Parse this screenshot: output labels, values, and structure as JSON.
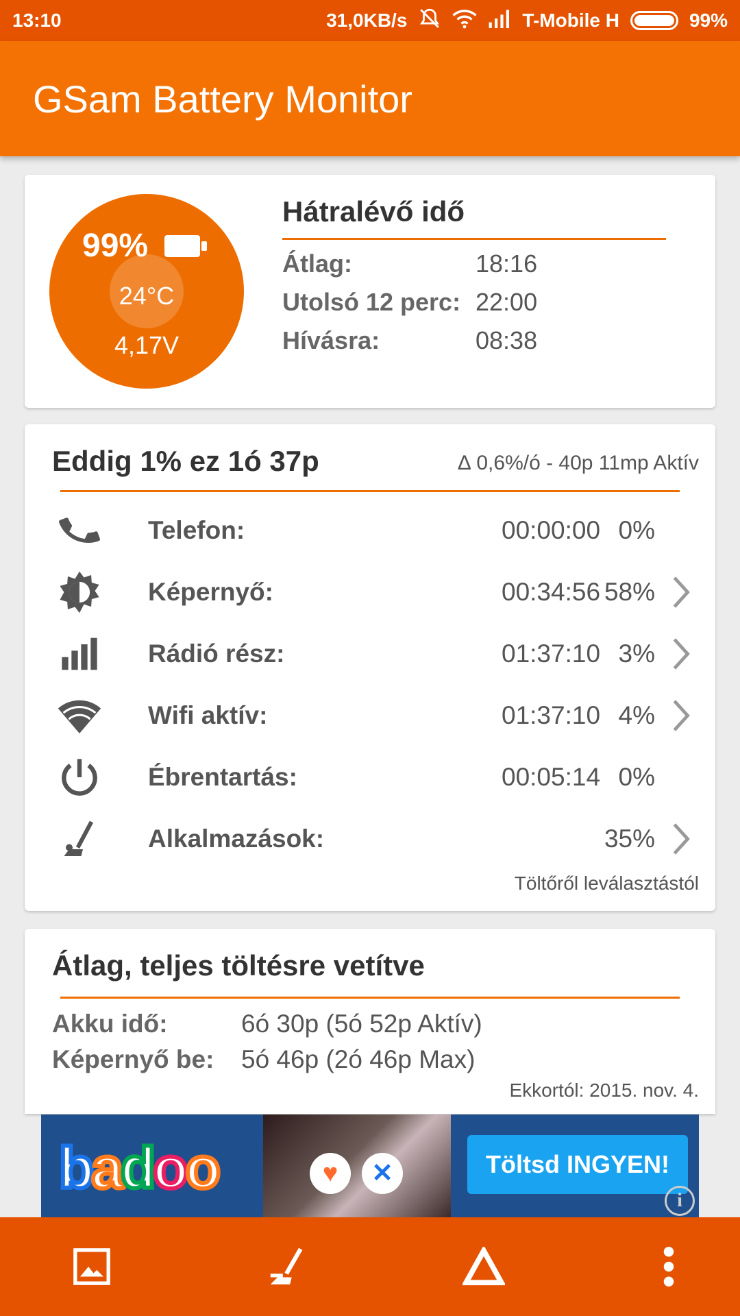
{
  "status_bar": {
    "time": "13:10",
    "network_speed": "31,0KB/s",
    "carrier": "T-Mobile H",
    "battery_percent": "99%",
    "icons": [
      "mute-icon",
      "wifi-icon",
      "signal-icon",
      "battery-icon"
    ]
  },
  "app_bar": {
    "title": "GSam Battery Monitor"
  },
  "battery": {
    "percent": "99%",
    "temperature": "24°C",
    "voltage": "4,17V",
    "color": "#ee6d00"
  },
  "remaining": {
    "title": "Hátralévő idő",
    "rows": [
      {
        "label": "Átlag:",
        "value": "18:16"
      },
      {
        "label": "Utolsó 12 perc:",
        "value": "22:00"
      },
      {
        "label": "Hívásra:",
        "value": "08:38"
      }
    ]
  },
  "usage": {
    "title": "Eddig 1% ez 1ó 37p",
    "subtitle": "∆ 0,6%/ó - 40p 11mp Aktív",
    "rows": [
      {
        "icon": "phone-icon",
        "label": "Telefon:",
        "time": "00:00:00",
        "percent": "0%",
        "has_detail": false
      },
      {
        "icon": "screen-brightness-icon",
        "label": "Képernyő:",
        "time": "00:34:56",
        "percent": "58%",
        "has_detail": true
      },
      {
        "icon": "signal-bars-icon",
        "label": "Rádió rész:",
        "time": "01:37:10",
        "percent": "3%",
        "has_detail": true
      },
      {
        "icon": "wifi-icon",
        "label": "Wifi aktív:",
        "time": "01:37:10",
        "percent": "4%",
        "has_detail": true
      },
      {
        "icon": "power-icon",
        "label": "Ébrentartás:",
        "time": "00:05:14",
        "percent": "0%",
        "has_detail": false
      },
      {
        "icon": "apps-icon",
        "label": "Alkalmazások:",
        "time": "",
        "percent": "35%",
        "has_detail": true
      }
    ],
    "footer": "Töltőről leválasztástól"
  },
  "projection": {
    "title": "Átlag, teljes töltésre vetítve",
    "rows": [
      {
        "label": "Akku idő:",
        "value": "6ó 30p (5ó 52p Aktív)"
      },
      {
        "label": "Képernyő be:",
        "value": "5ó 46p (2ó 46p Max)"
      }
    ],
    "footer": "Ekkortól: 2015. nov. 4."
  },
  "ad": {
    "brand": "badoo",
    "cta": "Töltsd INGYEN!",
    "info": "i"
  },
  "bottom_bar": {
    "items": [
      "gallery-icon",
      "apps-icon",
      "triangle-icon",
      "overflow-menu-icon"
    ]
  }
}
